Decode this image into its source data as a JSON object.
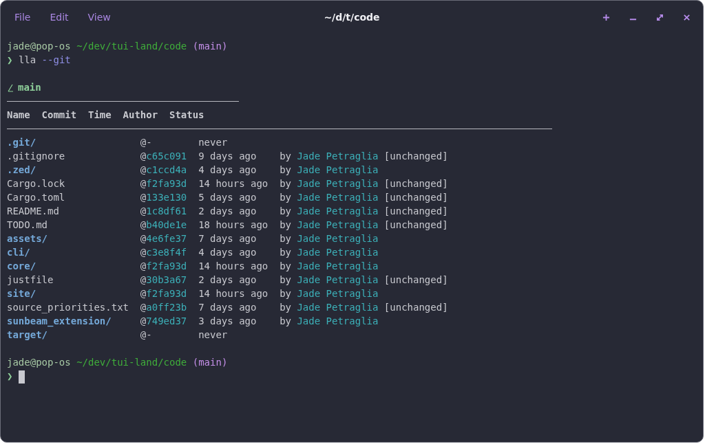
{
  "window": {
    "title": "~/d/t/code",
    "menu": [
      "File",
      "Edit",
      "View"
    ]
  },
  "prompt_1": {
    "user": "jade@pop-os",
    "path": "~/dev/tui-land/code",
    "branch": "(main)",
    "symbol": "❯",
    "command": "lla",
    "argument": "--git"
  },
  "branch_line": {
    "name": "main"
  },
  "table": {
    "columns": [
      "Name",
      "Commit",
      "Time",
      "Author",
      "Status"
    ],
    "rows": [
      {
        "name": ".git/",
        "kind": "dir",
        "at": "@",
        "hash": "-",
        "known": false,
        "time": "never"
      },
      {
        "name": ".gitignore",
        "kind": "file",
        "at": "@",
        "hash": "c65c091",
        "known": true,
        "time": "9 days ago",
        "by": "by",
        "author": "Jade Petraglia",
        "status": "[unchanged]"
      },
      {
        "name": ".zed/",
        "kind": "dir",
        "at": "@",
        "hash": "c1ccd4a",
        "known": true,
        "time": "4 days ago",
        "by": "by",
        "author": "Jade Petraglia"
      },
      {
        "name": "Cargo.lock",
        "kind": "file",
        "at": "@",
        "hash": "f2fa93d",
        "known": true,
        "time": "14 hours ago",
        "by": "by",
        "author": "Jade Petraglia",
        "status": "[unchanged]"
      },
      {
        "name": "Cargo.toml",
        "kind": "file",
        "at": "@",
        "hash": "133e130",
        "known": true,
        "time": "5 days ago",
        "by": "by",
        "author": "Jade Petraglia",
        "status": "[unchanged]"
      },
      {
        "name": "README.md",
        "kind": "file",
        "at": "@",
        "hash": "1c8df61",
        "known": true,
        "time": "2 days ago",
        "by": "by",
        "author": "Jade Petraglia",
        "status": "[unchanged]"
      },
      {
        "name": "TODO.md",
        "kind": "file",
        "at": "@",
        "hash": "b40de1e",
        "known": true,
        "time": "18 hours ago",
        "by": "by",
        "author": "Jade Petraglia",
        "status": "[unchanged]"
      },
      {
        "name": "assets/",
        "kind": "dir",
        "at": "@",
        "hash": "4e6fe37",
        "known": true,
        "time": "7 days ago",
        "by": "by",
        "author": "Jade Petraglia"
      },
      {
        "name": "cli/",
        "kind": "dir",
        "at": "@",
        "hash": "c3e8f4f",
        "known": true,
        "time": "4 days ago",
        "by": "by",
        "author": "Jade Petraglia"
      },
      {
        "name": "core/",
        "kind": "dir",
        "at": "@",
        "hash": "f2fa93d",
        "known": true,
        "time": "14 hours ago",
        "by": "by",
        "author": "Jade Petraglia"
      },
      {
        "name": "justfile",
        "kind": "file",
        "at": "@",
        "hash": "30b3a67",
        "known": true,
        "time": "2 days ago",
        "by": "by",
        "author": "Jade Petraglia",
        "status": "[unchanged]"
      },
      {
        "name": "site/",
        "kind": "dir",
        "at": "@",
        "hash": "f2fa93d",
        "known": true,
        "time": "14 hours ago",
        "by": "by",
        "author": "Jade Petraglia"
      },
      {
        "name": "source_priorities.txt",
        "kind": "file",
        "at": "@",
        "hash": "a0ff23b",
        "known": true,
        "time": "7 days ago",
        "by": "by",
        "author": "Jade Petraglia",
        "status": "[unchanged]"
      },
      {
        "name": "sunbeam_extension/",
        "kind": "dir",
        "at": "@",
        "hash": "749ed37",
        "known": true,
        "time": "3 days ago",
        "by": "by",
        "author": "Jade Petraglia"
      },
      {
        "name": "target/",
        "kind": "dir",
        "at": "@",
        "hash": "-",
        "known": false,
        "time": "never"
      }
    ]
  },
  "prompt_2": {
    "user": "jade@pop-os",
    "path": "~/dev/tui-land/code",
    "branch": "(main)",
    "symbol": "❯"
  }
}
